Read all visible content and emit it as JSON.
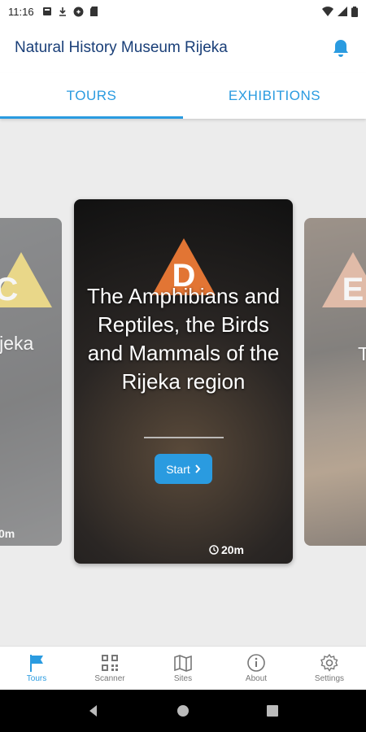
{
  "status_bar": {
    "time": "11:16"
  },
  "app_bar": {
    "title": "Natural History Museum Rijeka"
  },
  "tabs": [
    {
      "label": "TOURS",
      "active": true
    },
    {
      "label": "EXHIBITIONS",
      "active": false
    }
  ],
  "cards": {
    "left": {
      "letter": "C",
      "title": "ijeka",
      "duration": "0m",
      "badge_color": "#e7c63a"
    },
    "main": {
      "letter": "D",
      "title": "The Amphibians and Reptiles, the Birds and Mammals of the Rijeka region",
      "start_label": "Start",
      "duration": "20m",
      "badge_color": "#e27534"
    },
    "right": {
      "letter": "E",
      "title": "T",
      "badge_color": "#d89471"
    }
  },
  "bottom_nav": [
    {
      "label": "Tours",
      "icon": "flag-icon",
      "active": true
    },
    {
      "label": "Scanner",
      "icon": "qr-code-icon",
      "active": false
    },
    {
      "label": "Sites",
      "icon": "map-icon",
      "active": false
    },
    {
      "label": "About",
      "icon": "info-icon",
      "active": false
    },
    {
      "label": "Settings",
      "icon": "gear-icon",
      "active": false
    }
  ],
  "colors": {
    "accent": "#2a9be0",
    "title": "#1a3f78"
  }
}
